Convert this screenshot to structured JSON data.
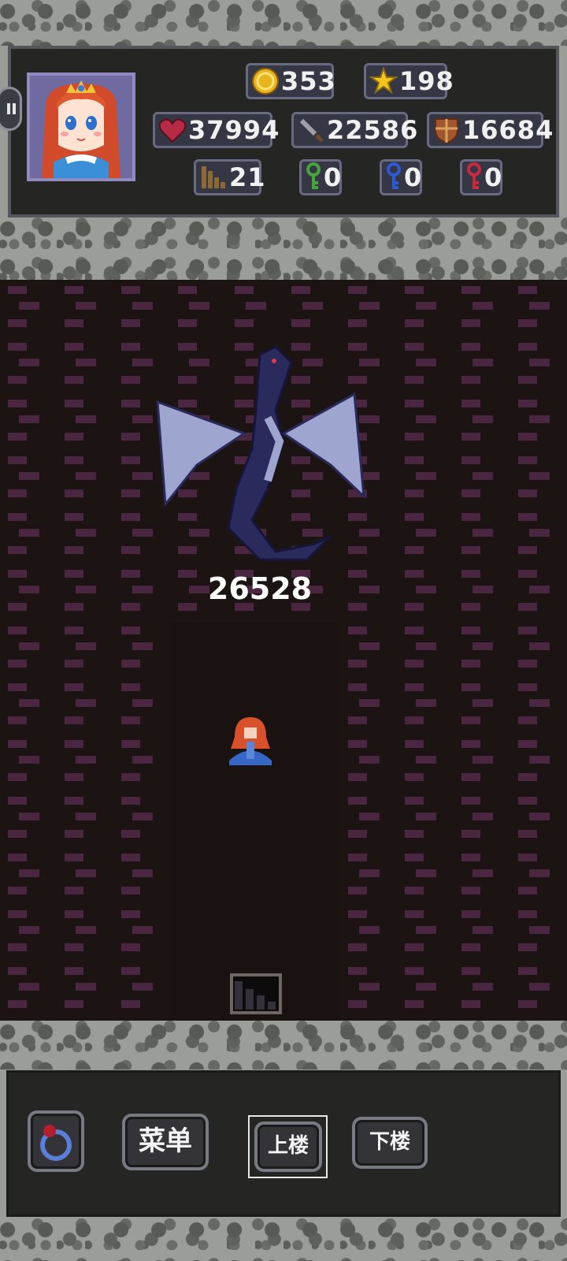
{
  "hud": {
    "gold": "353",
    "stars": "198",
    "hp": "37994",
    "attack": "22586",
    "defense": "16684",
    "floor": "21",
    "green_keys": "0",
    "blue_keys": "0",
    "red_keys": "0"
  },
  "field": {
    "monster_hp": "26528"
  },
  "controls": {
    "menu_label": "菜单",
    "up_label": "上楼",
    "down_label": "下楼"
  },
  "colors": {
    "panel": "#252523",
    "brick": "#4d2840",
    "floor": "#1c1313"
  },
  "icons": [
    "gold-coin-icon",
    "star-icon",
    "heart-icon",
    "sword-icon",
    "shield-icon",
    "stairs-icon",
    "green-key-icon",
    "blue-key-icon",
    "red-key-icon",
    "ring-icon"
  ]
}
